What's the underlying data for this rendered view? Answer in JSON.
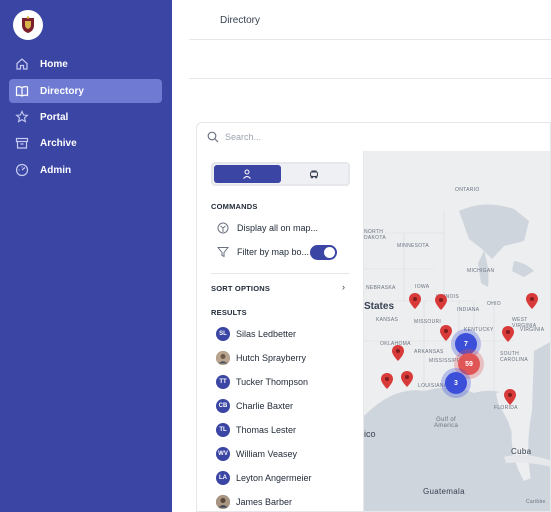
{
  "sidebar": {
    "items": [
      {
        "label": "Home",
        "icon": "home-icon",
        "active": false
      },
      {
        "label": "Directory",
        "icon": "book-icon",
        "active": true
      },
      {
        "label": "Portal",
        "icon": "star-icon",
        "active": false
      },
      {
        "label": "Archive",
        "icon": "archive-icon",
        "active": false
      },
      {
        "label": "Admin",
        "icon": "dashboard-icon",
        "active": false
      }
    ]
  },
  "header": {
    "title": "Directory"
  },
  "search": {
    "placeholder": "Search..."
  },
  "commands": {
    "heading": "COMMANDS",
    "display_all": "Display all on map...",
    "filter_by_bounds": "Filter by map bo...",
    "filter_enabled": true
  },
  "sort": {
    "heading": "SORT OPTIONS"
  },
  "results": {
    "heading": "RESULTS",
    "items": [
      {
        "initials": "SL",
        "name": "Silas Ledbetter",
        "photo": false
      },
      {
        "initials": "",
        "name": "Hutch Sprayberry",
        "photo": true
      },
      {
        "initials": "TT",
        "name": "Tucker Thompson",
        "photo": false
      },
      {
        "initials": "CB",
        "name": "Charlie Baxter",
        "photo": false
      },
      {
        "initials": "TL",
        "name": "Thomas Lester",
        "photo": false
      },
      {
        "initials": "WV",
        "name": "William Veasey",
        "photo": false
      },
      {
        "initials": "LA",
        "name": "Leyton Angermeier",
        "photo": false
      },
      {
        "initials": "",
        "name": "James Barber",
        "photo": true
      }
    ]
  },
  "map": {
    "labels": {
      "ontario": "ONTARIO",
      "north_dakota": "NORTH\nDAKOTA",
      "minnesota": "MINNESOTA",
      "nebraska": "NEBRASKA",
      "iowa": "IOWA",
      "illinois": "ILLINOIS",
      "michigan": "MICHIGAN",
      "ohio": "OHIO",
      "indiana": "INDIANA",
      "united_states": "States",
      "kansas": "KANSAS",
      "missouri": "MISSOURI",
      "kentucky": "KENTUCKY",
      "virginia": "VIRGINIA",
      "west_virginia": "WEST\nVIRGINIA",
      "oklahoma": "OKLAHOMA",
      "arkansas": "ARKANSAS",
      "mississippi": "MISSISSIPPI",
      "south_carolina": "SOUTH\nCAROLINA",
      "louisiana": "LOUISIANA",
      "florida": "FLORIDA",
      "gulf": "Gulf of\nAmerica",
      "mexico": "ico",
      "cuba": "Cuba",
      "guatemala": "Guatemala",
      "attribution": "Caribbe"
    },
    "clusters": [
      {
        "count": "7",
        "color": "#3b4fd8"
      },
      {
        "count": "59",
        "color": "#e05555"
      },
      {
        "count": "3",
        "color": "#3b4fd8"
      }
    ],
    "pin_color": "#d83a3a"
  }
}
